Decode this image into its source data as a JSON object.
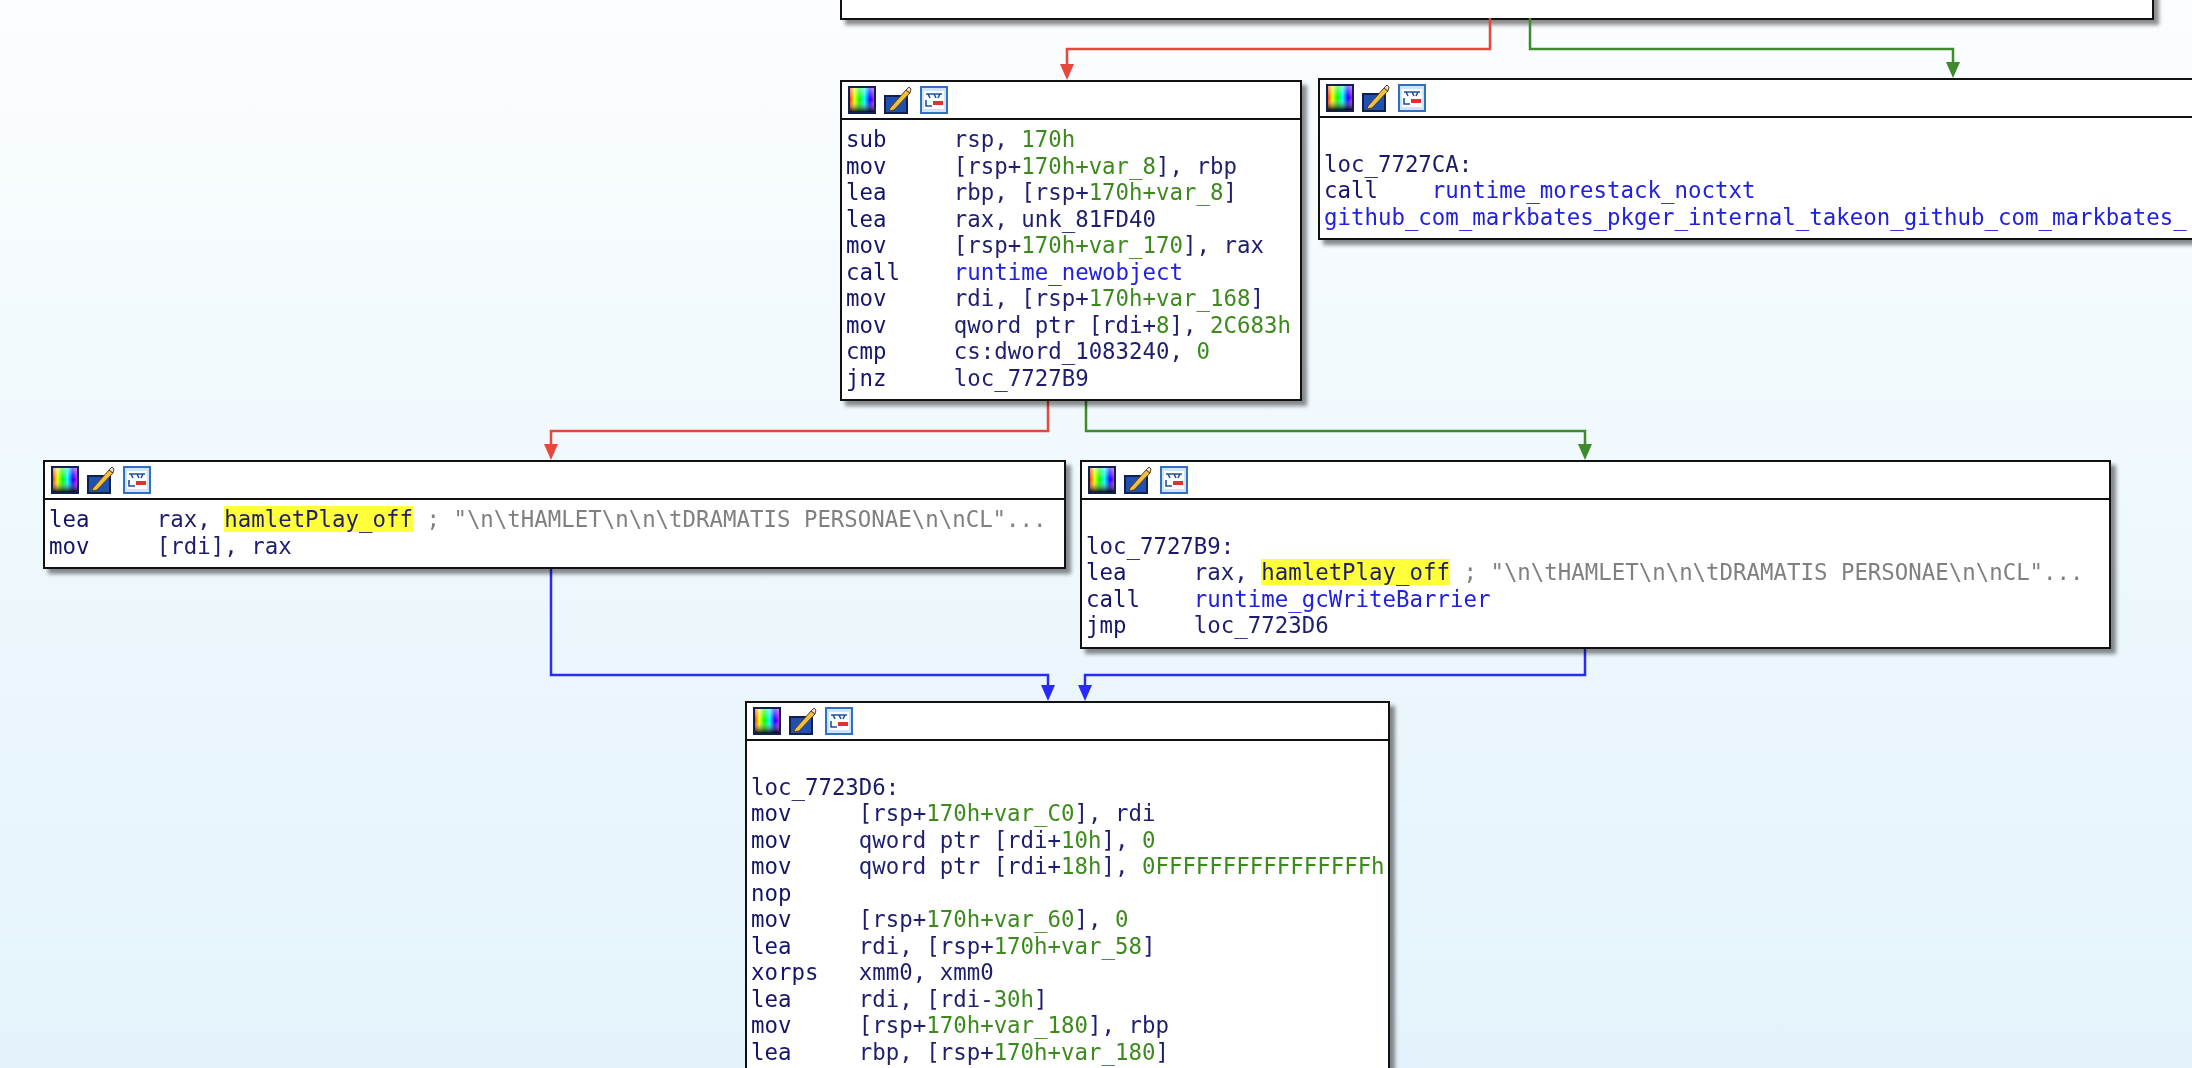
{
  "blocks": [
    {
      "lines": [
        {
          "mnemonic": "sub",
          "ops": [
            {
              "kind": "reg",
              "text": "rsp, "
            },
            {
              "kind": "num",
              "text": "170h"
            }
          ]
        },
        {
          "mnemonic": "mov",
          "ops": [
            {
              "kind": "reg",
              "text": "[rsp+"
            },
            {
              "kind": "num",
              "text": "170h+var_8"
            },
            {
              "kind": "reg",
              "text": "], rbp"
            }
          ]
        },
        {
          "mnemonic": "lea",
          "ops": [
            {
              "kind": "reg",
              "text": "rbp, [rsp+"
            },
            {
              "kind": "num",
              "text": "170h+var_8"
            },
            {
              "kind": "reg",
              "text": "]"
            }
          ]
        },
        {
          "mnemonic": "lea",
          "ops": [
            {
              "kind": "reg",
              "text": "rax, unk_81FD40"
            }
          ]
        },
        {
          "mnemonic": "mov",
          "ops": [
            {
              "kind": "reg",
              "text": "[rsp+"
            },
            {
              "kind": "num",
              "text": "170h+var_170"
            },
            {
              "kind": "reg",
              "text": "], rax"
            }
          ]
        },
        {
          "mnemonic": "call",
          "ops": [
            {
              "kind": "name",
              "text": "runtime_newobject"
            }
          ]
        },
        {
          "mnemonic": "mov",
          "ops": [
            {
              "kind": "reg",
              "text": "rdi, [rsp+"
            },
            {
              "kind": "num",
              "text": "170h+var_168"
            },
            {
              "kind": "reg",
              "text": "]"
            }
          ]
        },
        {
          "mnemonic": "mov",
          "ops": [
            {
              "kind": "reg",
              "text": "qword ptr [rdi+"
            },
            {
              "kind": "num",
              "text": "8"
            },
            {
              "kind": "reg",
              "text": "], "
            },
            {
              "kind": "num",
              "text": "2C683h"
            }
          ]
        },
        {
          "mnemonic": "cmp",
          "ops": [
            {
              "kind": "reg",
              "text": "cs:dword_1083240, "
            },
            {
              "kind": "num",
              "text": "0"
            }
          ]
        },
        {
          "mnemonic": "jnz",
          "ops": [
            {
              "kind": "reg",
              "text": "loc_7727B9"
            }
          ]
        }
      ]
    },
    {
      "lines": [
        {
          "label": "loc_7727CA:"
        },
        {
          "mnemonic": "call",
          "ops": [
            {
              "kind": "name",
              "text": "runtime_morestack_noctxt"
            }
          ]
        },
        {
          "ops": [
            {
              "kind": "name",
              "text": "github_com_markbates_pkger_internal_takeon_github_com_markbates_"
            }
          ]
        }
      ]
    },
    {
      "lines": [
        {
          "mnemonic": "lea",
          "ops": [
            {
              "kind": "reg",
              "text": "rax, "
            },
            {
              "kind": "highlight",
              "text": "hamletPlay_off"
            },
            {
              "kind": "comment",
              "text": " ; \"\\n\\tHAMLET\\n\\n\\tDRAMATIS PERSONAE\\n\\nCL\"..."
            }
          ]
        },
        {
          "mnemonic": "mov",
          "ops": [
            {
              "kind": "reg",
              "text": "[rdi], rax"
            }
          ]
        }
      ]
    },
    {
      "lines": [
        {
          "label": "loc_7727B9:"
        },
        {
          "mnemonic": "lea",
          "ops": [
            {
              "kind": "reg",
              "text": "rax, "
            },
            {
              "kind": "highlight",
              "text": "hamletPlay_off"
            },
            {
              "kind": "comment",
              "text": " ; \"\\n\\tHAMLET\\n\\n\\tDRAMATIS PERSONAE\\n\\nCL\"..."
            }
          ]
        },
        {
          "mnemonic": "call",
          "ops": [
            {
              "kind": "name",
              "text": "runtime_gcWriteBarrier"
            }
          ]
        },
        {
          "mnemonic": "jmp",
          "ops": [
            {
              "kind": "reg",
              "text": "loc_7723D6"
            }
          ]
        }
      ]
    },
    {
      "lines": [
        {
          "label": "loc_7723D6:"
        },
        {
          "mnemonic": "mov",
          "ops": [
            {
              "kind": "reg",
              "text": "[rsp+"
            },
            {
              "kind": "num",
              "text": "170h+var_C0"
            },
            {
              "kind": "reg",
              "text": "], rdi"
            }
          ]
        },
        {
          "mnemonic": "mov",
          "ops": [
            {
              "kind": "reg",
              "text": "qword ptr [rdi+"
            },
            {
              "kind": "num",
              "text": "10h"
            },
            {
              "kind": "reg",
              "text": "], "
            },
            {
              "kind": "num",
              "text": "0"
            }
          ]
        },
        {
          "mnemonic": "mov",
          "ops": [
            {
              "kind": "reg",
              "text": "qword ptr [rdi+"
            },
            {
              "kind": "num",
              "text": "18h"
            },
            {
              "kind": "reg",
              "text": "], "
            },
            {
              "kind": "num",
              "text": "0FFFFFFFFFFFFFFFFh"
            }
          ]
        },
        {
          "mnemonic": "nop"
        },
        {
          "mnemonic": "mov",
          "ops": [
            {
              "kind": "reg",
              "text": "[rsp+"
            },
            {
              "kind": "num",
              "text": "170h+var_60"
            },
            {
              "kind": "reg",
              "text": "], "
            },
            {
              "kind": "num",
              "text": "0"
            }
          ]
        },
        {
          "mnemonic": "lea",
          "ops": [
            {
              "kind": "reg",
              "text": "rdi, [rsp+"
            },
            {
              "kind": "num",
              "text": "170h+var_58"
            },
            {
              "kind": "reg",
              "text": "]"
            }
          ]
        },
        {
          "mnemonic": "xorps",
          "ops": [
            {
              "kind": "reg",
              "text": "xmm0, xmm0"
            }
          ]
        },
        {
          "mnemonic": "lea",
          "ops": [
            {
              "kind": "reg",
              "text": "rdi, [rdi-"
            },
            {
              "kind": "num",
              "text": "30h"
            },
            {
              "kind": "reg",
              "text": "]"
            }
          ]
        },
        {
          "mnemonic": "mov",
          "ops": [
            {
              "kind": "reg",
              "text": "[rsp+"
            },
            {
              "kind": "num",
              "text": "170h+var_180"
            },
            {
              "kind": "reg",
              "text": "], rbp"
            }
          ]
        },
        {
          "mnemonic": "lea",
          "ops": [
            {
              "kind": "reg",
              "text": "rbp, [rsp+"
            },
            {
              "kind": "num",
              "text": "170h+var_180"
            },
            {
              "kind": "reg",
              "text": "]"
            }
          ]
        }
      ]
    }
  ],
  "edges": [
    {
      "color": "#e8483c"
    },
    {
      "color": "#3f8a2a"
    },
    {
      "color": "#e8483c"
    },
    {
      "color": "#3f8a2a"
    },
    {
      "color": "#2a2aff"
    },
    {
      "color": "#2a2aff"
    }
  ]
}
